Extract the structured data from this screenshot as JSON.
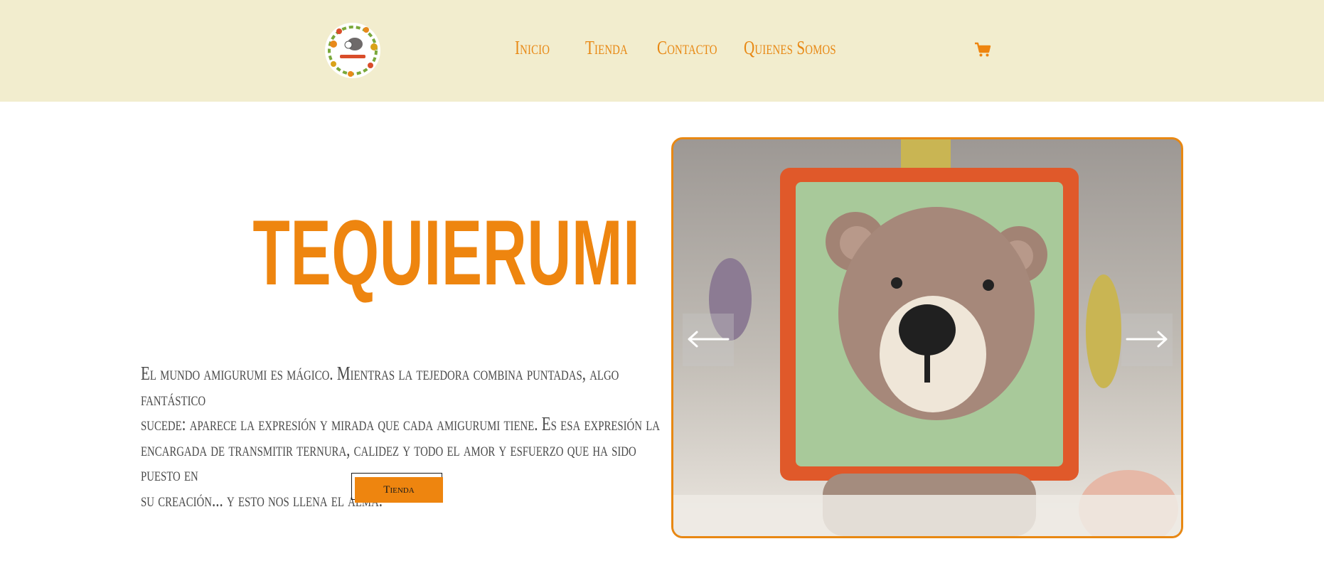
{
  "nav": {
    "links": [
      {
        "label": "Inicio"
      },
      {
        "label": "Tienda"
      },
      {
        "label": "Contacto"
      },
      {
        "label": "Quienes Somos"
      }
    ]
  },
  "hero": {
    "title": "TEQUIERUMI",
    "text_lines": [
      "El mundo amigurumi es mágico. Mientras la tejedora combina puntadas, algo fantástico",
      "sucede: aparece la expresión y mirada que cada amigurumi tiene. Es esa expresión la",
      "encargada de transmitir ternura, calidez y todo el amor y esfuerzo que ha sido puesto en",
      "su creación... y esto nos llena el alma."
    ],
    "button_label": "Tienda"
  },
  "icons": {
    "logo": "tequierumi-logo",
    "cart": "shopping-cart-icon",
    "prev": "arrow-left-icon",
    "next": "arrow-right-icon"
  },
  "colors": {
    "header_bg": "#f2edce",
    "accent": "#ee850f",
    "text": "#4a4a4a"
  }
}
